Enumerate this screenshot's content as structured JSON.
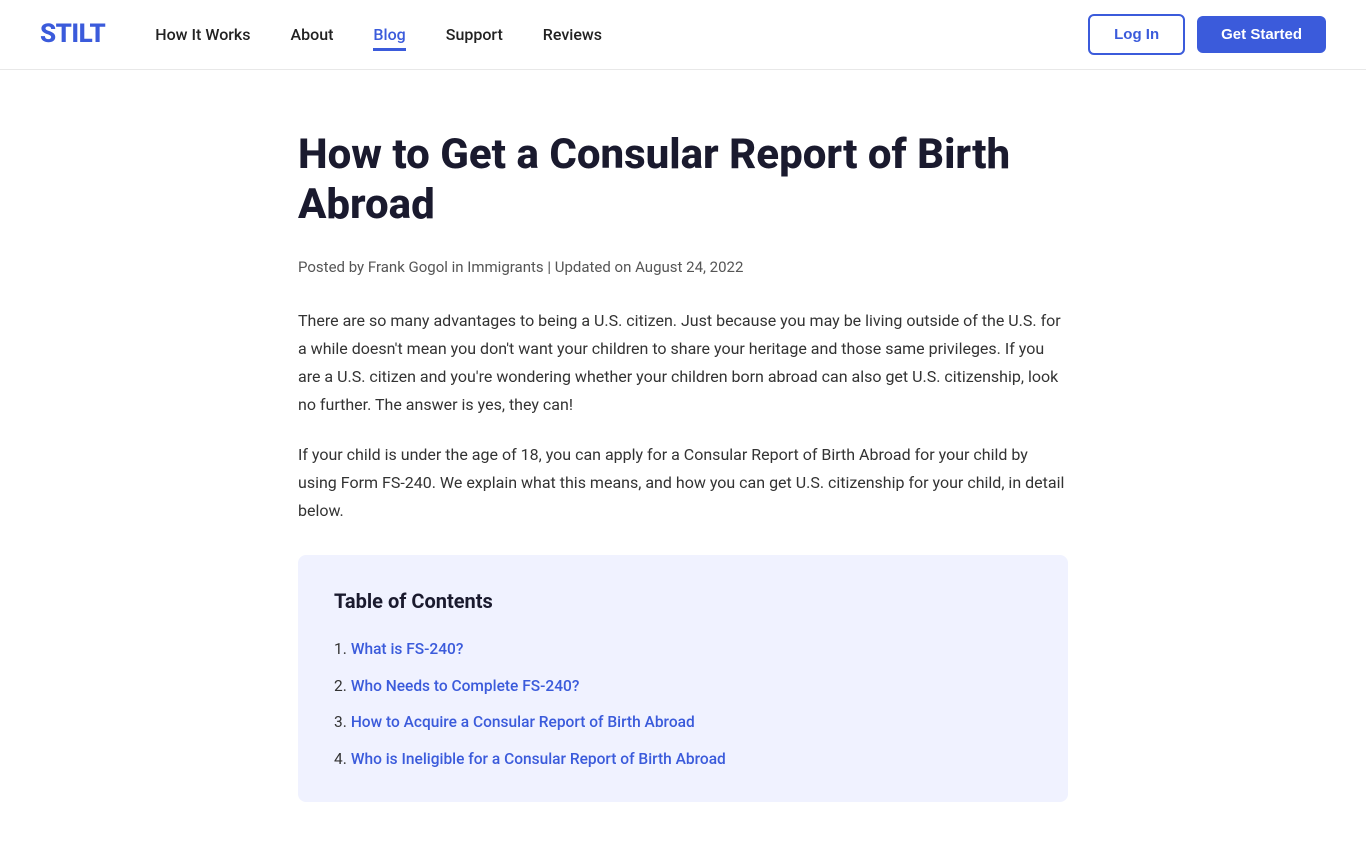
{
  "nav": {
    "logo": "STILT",
    "links": [
      {
        "label": "How It Works",
        "active": false
      },
      {
        "label": "About",
        "active": false
      },
      {
        "label": "Blog",
        "active": true
      },
      {
        "label": "Support",
        "active": false
      },
      {
        "label": "Reviews",
        "active": false
      }
    ],
    "login_label": "Log In",
    "get_started_label": "Get Started"
  },
  "article": {
    "title": "How to Get a Consular Report of Birth Abroad",
    "meta": "Posted by Frank Gogol in Immigrants | Updated on August 24, 2022",
    "paragraphs": [
      "There are so many advantages to being a U.S. citizen. Just because you may be living outside of the U.S. for a while doesn't mean you don't want your children to share your heritage and those same privileges. If you are a U.S. citizen and you're wondering whether your children born abroad can also get U.S. citizenship, look no further. The answer is yes, they can!",
      "If your child is under the age of 18, you can apply for a Consular Report of Birth Abroad for your child by using Form FS-240. We explain what this means, and how you can get U.S. citizenship for your child, in detail below."
    ]
  },
  "toc": {
    "title": "Table of Contents",
    "items": [
      {
        "num": "1.",
        "label": "What is FS-240?",
        "href": "#what-is-fs-240"
      },
      {
        "num": "2.",
        "label": "Who Needs to Complete FS-240?",
        "href": "#who-needs"
      },
      {
        "num": "3.",
        "label": "How to Acquire a Consular Report of Birth Abroad",
        "href": "#how-to-acquire"
      },
      {
        "num": "4.",
        "label": "Who is Ineligible for a Consular Report of Birth Abroad",
        "href": "#ineligible"
      }
    ]
  }
}
